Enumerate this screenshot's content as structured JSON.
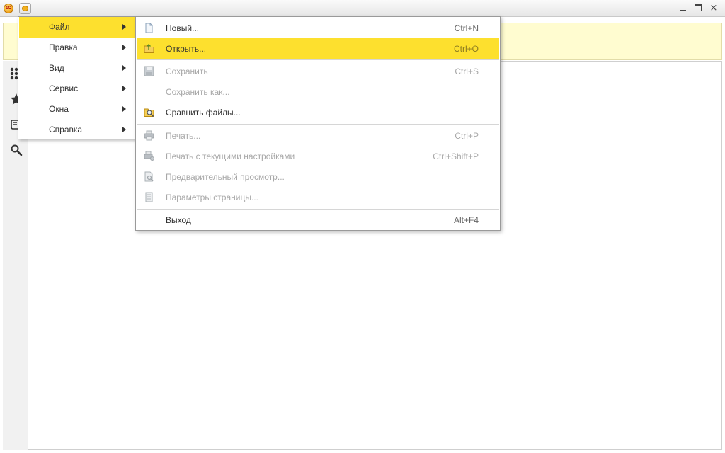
{
  "window": {
    "logo_text": "1С",
    "controls": {
      "minimize": "minimize-icon",
      "maximize": "maximize-icon",
      "close": "×"
    }
  },
  "main_menu": {
    "items": [
      {
        "label": "Файл",
        "active": true
      },
      {
        "label": "Правка"
      },
      {
        "label": "Вид"
      },
      {
        "label": "Сервис"
      },
      {
        "label": "Окна"
      },
      {
        "label": "Справка"
      }
    ]
  },
  "file_menu": {
    "items": [
      {
        "label": "Новый...",
        "shortcut": "Ctrl+N",
        "icon": "new-document-icon",
        "enabled": true
      },
      {
        "label": "Открыть...",
        "shortcut": "Ctrl+O",
        "icon": "open-folder-icon",
        "enabled": true,
        "highlighted": true
      },
      {
        "label": "Сохранить",
        "shortcut": "Ctrl+S",
        "icon": "save-icon",
        "enabled": false
      },
      {
        "label": "Сохранить как...",
        "shortcut": "",
        "enabled": false
      },
      {
        "label": "Сравнить файлы...",
        "shortcut": "",
        "icon": "compare-files-icon",
        "enabled": true
      },
      {
        "label": "Печать...",
        "shortcut": "Ctrl+P",
        "icon": "print-icon",
        "enabled": false
      },
      {
        "label": "Печать с текущими настройками",
        "shortcut": "Ctrl+Shift+P",
        "icon": "print-current-icon",
        "enabled": false
      },
      {
        "label": "Предварительный просмотр...",
        "shortcut": "",
        "icon": "preview-icon",
        "enabled": false
      },
      {
        "label": "Параметры страницы...",
        "shortcut": "",
        "icon": "page-setup-icon",
        "enabled": false
      },
      {
        "label": "Выход",
        "shortcut": "Alt+F4",
        "enabled": true
      }
    ]
  },
  "left_panel": {
    "icons": [
      "apps-grid-icon",
      "favorites-star-icon",
      "history-icon",
      "search-icon"
    ]
  },
  "colors": {
    "highlight": "#fde02e",
    "info_strip": "#fffcd0",
    "disabled_text": "#a8a8a8"
  }
}
